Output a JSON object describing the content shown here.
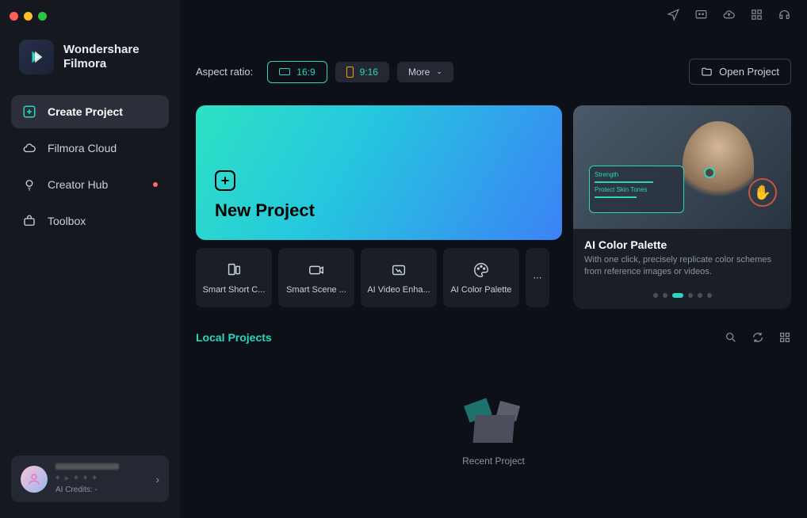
{
  "brand": {
    "line1": "Wondershare",
    "line2": "Filmora"
  },
  "sidebar": {
    "items": [
      {
        "label": "Create Project"
      },
      {
        "label": "Filmora Cloud"
      },
      {
        "label": "Creator Hub"
      },
      {
        "label": "Toolbox"
      }
    ]
  },
  "user": {
    "credits": "AI Credits: -"
  },
  "toolbar": {
    "aspect_label": "Aspect ratio:",
    "r169": "16:9",
    "r916": "9:16",
    "more": "More",
    "open": "Open Project"
  },
  "new_project": {
    "title": "New Project"
  },
  "mini": [
    "Smart Short C...",
    "Smart Scene ...",
    "AI Video Enha...",
    "AI Color Palette"
  ],
  "feature": {
    "title": "AI Color Palette",
    "desc": "With one click, precisely replicate color schemes from reference images or videos."
  },
  "thumb_labels": {
    "strength": "Strength",
    "protect": "Protect Skin Tones"
  },
  "local": {
    "title": "Local Projects"
  },
  "empty": {
    "label": "Recent Project"
  }
}
